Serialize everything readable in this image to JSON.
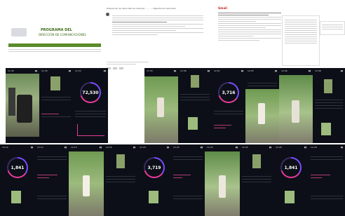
{
  "top_docs": {
    "left_doc": {
      "header_title": "PROGRAMA DEL",
      "header_subtitle": "DIRECCIÓN DE COMUNICACIONES",
      "accent": "#5a8a2a"
    },
    "email_doc": {
      "subject": "Evaluación de Velocidad de Internet - ... - ... Reporte de Velocidad"
    },
    "gmail_doc": {
      "brand": "Gmail"
    }
  },
  "phones": [
    {
      "value": ""
    },
    {
      "value": "72,530"
    },
    {
      "value": ""
    },
    {
      "value": "3,716"
    },
    {
      "value": ""
    },
    {
      "value": "1,841"
    },
    {
      "value": "3,719"
    },
    {
      "value": ""
    },
    {
      "value": "1,841"
    }
  ],
  "colors": {
    "phone_bg": "#0c0f17",
    "ring_purple": "#7a4bff",
    "ring_pink": "#e83a9a"
  }
}
